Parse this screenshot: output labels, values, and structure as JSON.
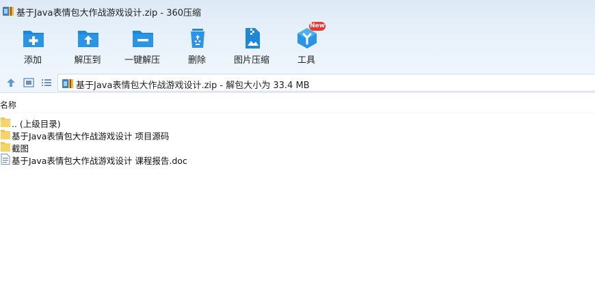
{
  "window": {
    "title": "基于Java表情包大作战游戏设计.zip - 360压缩"
  },
  "toolbar": {
    "items": [
      {
        "label": "添加",
        "icon": "add-folder-icon"
      },
      {
        "label": "解压到",
        "icon": "extract-to-folder-icon"
      },
      {
        "label": "一键解压",
        "icon": "one-click-extract-icon"
      },
      {
        "label": "删除",
        "icon": "recycle-bin-icon"
      },
      {
        "label": "图片压缩",
        "icon": "image-compress-icon"
      },
      {
        "label": "工具",
        "icon": "tools-cube-icon"
      }
    ],
    "new_badge": "New"
  },
  "navbar": {
    "address_text": "基于Java表情包大作战游戏设计.zip - 解包大小为 33.4 MB"
  },
  "list": {
    "column_name": "名称",
    "rows": [
      {
        "name": ".. (上级目录)",
        "type": "folder"
      },
      {
        "name": "基于Java表情包大作战游戏设计 项目源码",
        "type": "folder"
      },
      {
        "name": "截图",
        "type": "folder"
      },
      {
        "name": "基于Java表情包大作战游戏设计 课程报告.doc",
        "type": "doc"
      }
    ]
  },
  "colors": {
    "accent_blue": "#1e88d8",
    "badge_red": "#e8352d",
    "folder_yellow": "#f5c54a"
  }
}
